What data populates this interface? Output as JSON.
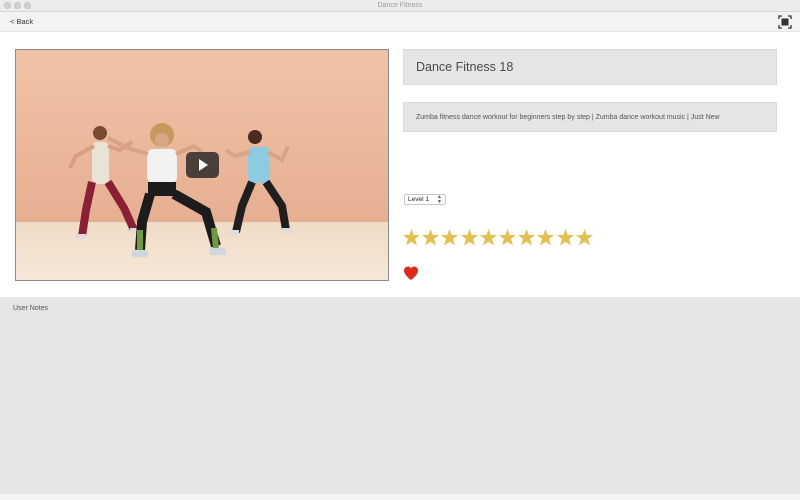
{
  "window": {
    "title": "Dance Fitness"
  },
  "toolbar": {
    "back_label": "< Back"
  },
  "video": {
    "title": "Dance Fitness 18",
    "description": "Zumba fitness dance workout for beginners step by step | Zumba dance workout music | Just New"
  },
  "level": {
    "selected": "Level 1"
  },
  "rating": {
    "stars": 10,
    "filled": 10,
    "star_color": "#e3c04f"
  },
  "favorite": {
    "state": "on",
    "color": "#e0281c"
  },
  "notes": {
    "label": "User Notes",
    "value": ""
  },
  "colors": {
    "panel_gray": "#e5e5e5",
    "notes_gray": "#e6e6e6"
  },
  "icons": {
    "back": "chevron-left-icon",
    "fullscreen": "fullscreen-icon",
    "play": "play-icon",
    "star": "star-icon",
    "heart": "heart-icon"
  }
}
